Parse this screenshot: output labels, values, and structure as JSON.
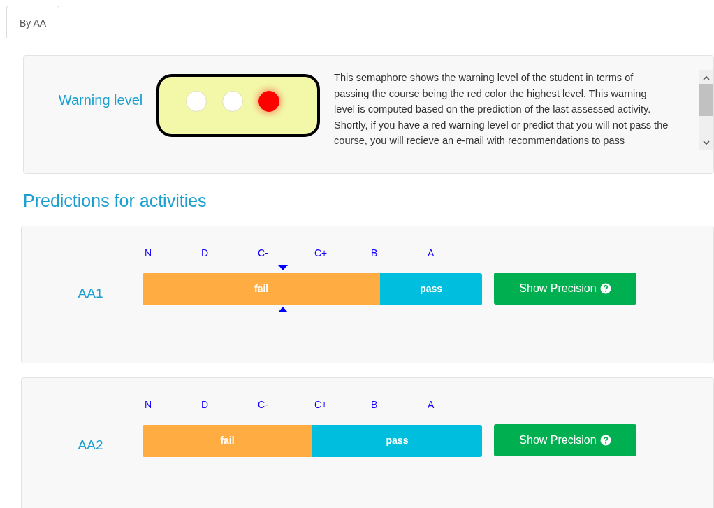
{
  "tabs": [
    {
      "label": "By AA",
      "selected": true
    }
  ],
  "warning": {
    "label": "Warning level",
    "lights": [
      {
        "on": false
      },
      {
        "on": false
      },
      {
        "on": true,
        "color": "#ff0000"
      }
    ],
    "description": "This semaphore shows the warning level of the student in terms of passing the course being the red color the highest level. This warning level is computed based on the prediction of the last assessed activity. Shortly, if you have a red warning level or predict that you will not pass the course, you will recieve an e-mail with recommendations to pass"
  },
  "predictions_title": "Predictions for activities",
  "activities": [
    {
      "name": "AA1",
      "grades": [
        {
          "label": "N",
          "selected": false
        },
        {
          "label": "D",
          "selected": false
        },
        {
          "label": "C-",
          "selected": true
        },
        {
          "label": "C+",
          "selected": false
        },
        {
          "label": "B",
          "selected": false
        },
        {
          "label": "A",
          "selected": false
        }
      ],
      "fail_label": "fail",
      "pass_label": "pass",
      "level": 0.7,
      "button": "Show Precision"
    },
    {
      "name": "AA2",
      "grades": [
        {
          "label": "N",
          "selected": false
        },
        {
          "label": "D",
          "selected": false
        },
        {
          "label": "C-",
          "selected": false
        },
        {
          "label": "C+",
          "selected": false
        },
        {
          "label": "B",
          "selected": false
        },
        {
          "label": "A",
          "selected": false
        }
      ],
      "fail_label": "fail",
      "pass_label": "pass",
      "level": 0.5,
      "button": "Show Precision"
    }
  ]
}
